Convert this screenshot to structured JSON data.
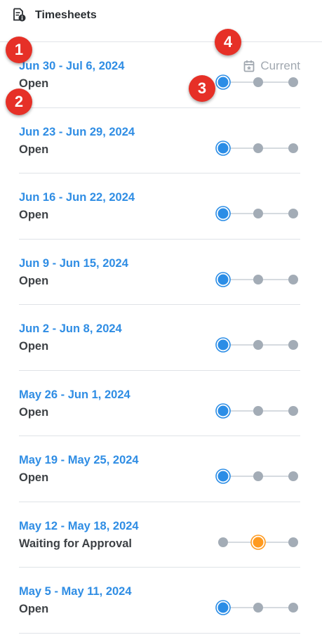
{
  "header": {
    "title": "Timesheets",
    "icon": "timesheet-doc-icon"
  },
  "current_label": "Current",
  "colors": {
    "active_blue": "#2b8de6",
    "pending_orange": "#ff9a1f",
    "inactive_gray": "#a3acb6",
    "date_blue": "#2f8de4",
    "callout_red": "#e63027"
  },
  "callouts": [
    "1",
    "2",
    "3",
    "4"
  ],
  "timesheets": [
    {
      "date_range": "Jun 30 - Jul 6, 2024",
      "status": "Open",
      "active_step": 1,
      "step_color": "blue",
      "current": true
    },
    {
      "date_range": "Jun 23 - Jun 29, 2024",
      "status": "Open",
      "active_step": 1,
      "step_color": "blue"
    },
    {
      "date_range": "Jun 16 - Jun 22, 2024",
      "status": "Open",
      "active_step": 1,
      "step_color": "blue"
    },
    {
      "date_range": "Jun 9 - Jun 15, 2024",
      "status": "Open",
      "active_step": 1,
      "step_color": "blue"
    },
    {
      "date_range": "Jun 2 - Jun 8, 2024",
      "status": "Open",
      "active_step": 1,
      "step_color": "blue"
    },
    {
      "date_range": "May 26 - Jun 1, 2024",
      "status": "Open",
      "active_step": 1,
      "step_color": "blue"
    },
    {
      "date_range": "May 19 - May 25, 2024",
      "status": "Open",
      "active_step": 1,
      "step_color": "blue"
    },
    {
      "date_range": "May 12 - May 18, 2024",
      "status": "Waiting for Approval",
      "active_step": 2,
      "step_color": "orange"
    },
    {
      "date_range": "May 5 - May 11, 2024",
      "status": "Open",
      "active_step": 1,
      "step_color": "blue"
    }
  ]
}
